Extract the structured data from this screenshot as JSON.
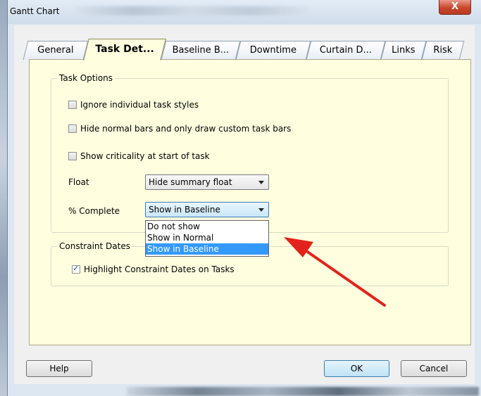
{
  "window": {
    "title": "Gantt Chart",
    "close_label": "X"
  },
  "tabs": [
    {
      "label": "General",
      "active": false
    },
    {
      "label": "Task Det...",
      "active": true
    },
    {
      "label": "Baseline B...",
      "active": false
    },
    {
      "label": "Downtime",
      "active": false
    },
    {
      "label": "Curtain D...",
      "active": false
    },
    {
      "label": "Links",
      "active": false
    },
    {
      "label": "Risk",
      "active": false
    }
  ],
  "task_options": {
    "group_label": "Task Options",
    "checkboxes": [
      {
        "label": "Ignore individual task styles",
        "checked": false
      },
      {
        "label": "Hide normal bars and only draw custom task bars",
        "checked": false
      },
      {
        "label": "Show criticality at start of task",
        "checked": false
      }
    ],
    "float": {
      "label": "Float",
      "value": "Hide summary float"
    },
    "percent_complete": {
      "label": "% Complete",
      "value": "Show in Baseline"
    }
  },
  "dropdown": {
    "options": [
      "Do not show",
      "Show in Normal",
      "Show in Baseline"
    ],
    "selected_index": 2
  },
  "constraint_dates": {
    "group_label": "Constraint Dates",
    "checkbox": {
      "label": "Highlight Constraint Dates on Tasks",
      "checked": true
    }
  },
  "buttons": {
    "help": "Help",
    "ok": "OK",
    "cancel": "Cancel"
  },
  "colors": {
    "panel": "#ffffe0",
    "selection": "#3399ff",
    "arrow": "#e3231b"
  }
}
